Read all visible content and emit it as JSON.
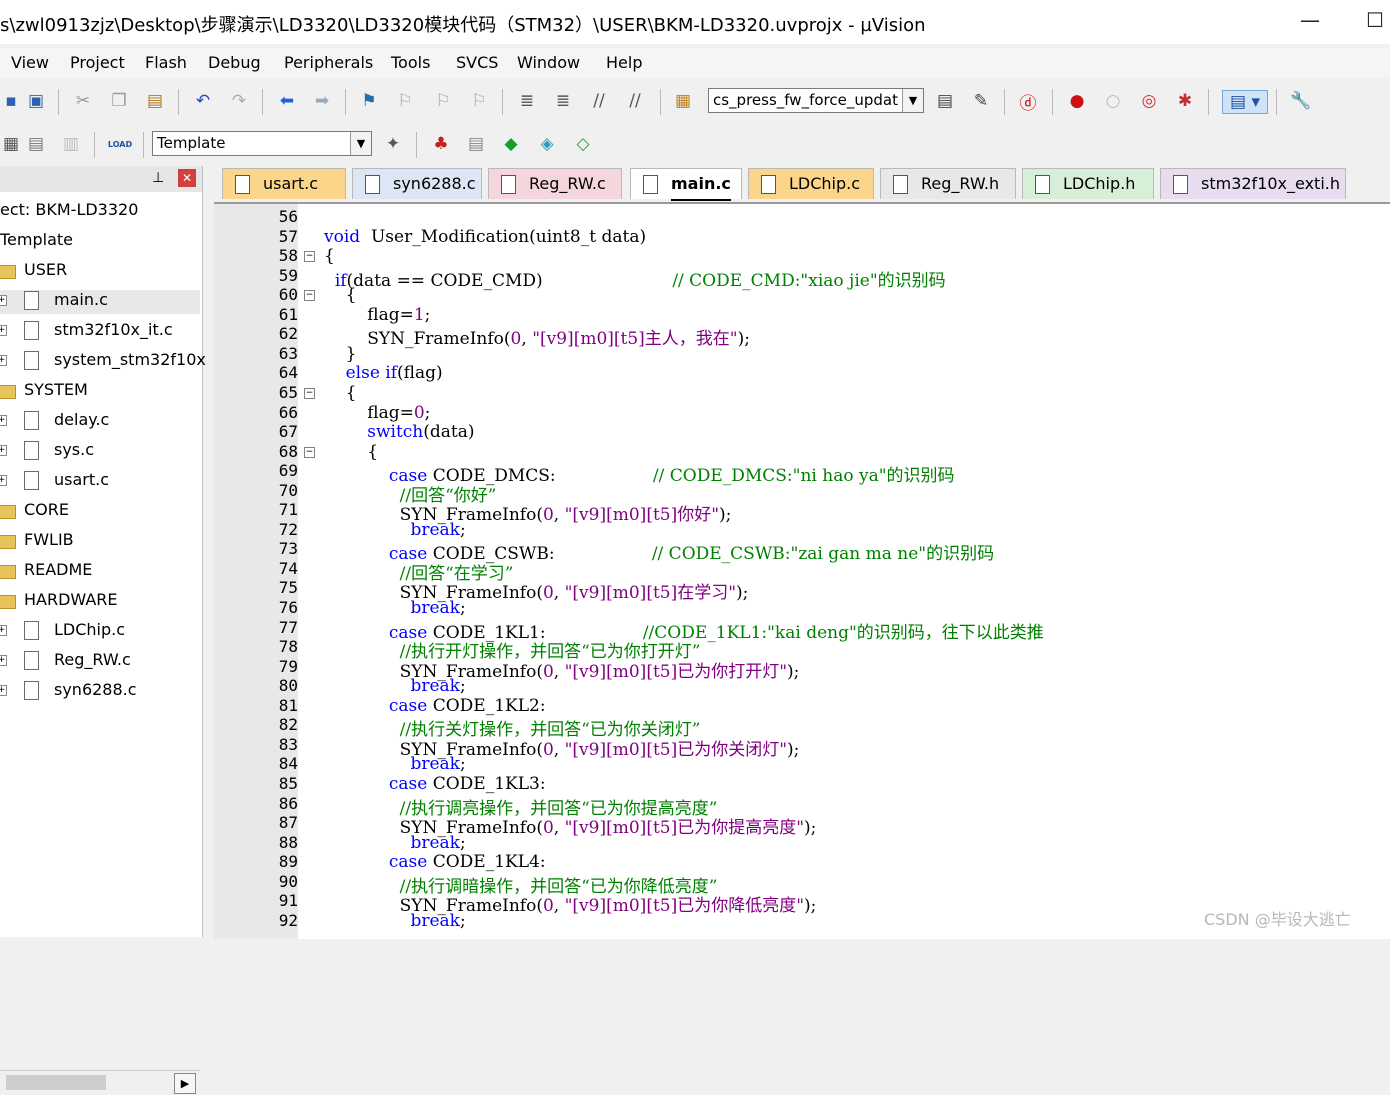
{
  "window": {
    "title": "s\\zwl0913zjz\\Desktop\\步骤演示\\LD3320\\LD3320模块代码（STM32）\\USER\\BKM-LD3320.uvprojx - µVision",
    "minimize": "—",
    "maximize": "☐"
  },
  "menu": [
    "View",
    "Project",
    "Flash",
    "Debug",
    "Peripherals",
    "Tools",
    "SVCS",
    "Window",
    "Help"
  ],
  "toolbar": {
    "function_combo": "cs_press_fw_force_updat",
    "target_combo": "Template",
    "load_label": "LOAD"
  },
  "project": {
    "pin": "⊥",
    "close": "✕",
    "title": "ect: BKM-LD3320",
    "target": "Template",
    "groups": [
      {
        "name": "USER",
        "files": [
          "main.c",
          "stm32f10x_it.c",
          "system_stm32f10x"
        ]
      },
      {
        "name": "SYSTEM",
        "files": [
          "delay.c",
          "sys.c",
          "usart.c"
        ]
      },
      {
        "name": "CORE",
        "files": []
      },
      {
        "name": "FWLIB",
        "files": []
      },
      {
        "name": "README",
        "files": []
      },
      {
        "name": "HARDWARE",
        "files": [
          "LDChip.c",
          "Reg_RW.c",
          "syn6288.c"
        ]
      }
    ]
  },
  "tabs": [
    {
      "label": "usart.c",
      "color": "#fbd58a"
    },
    {
      "label": "syn6288.c",
      "color": "#dce6f5"
    },
    {
      "label": "Reg_RW.c",
      "color": "#f5d6dc"
    },
    {
      "label": "main.c",
      "color": "#ffffff",
      "active": true
    },
    {
      "label": "LDChip.c",
      "color": "#fbd58a"
    },
    {
      "label": "Reg_RW.h",
      "color": "#e8e8e8"
    },
    {
      "label": "LDChip.h",
      "color": "#d6efd6"
    },
    {
      "label": "stm32f10x_exti.h",
      "color": "#e8dcf0"
    }
  ],
  "code_lines": [
    {
      "n": "56",
      "parts": []
    },
    {
      "n": "57",
      "parts": [
        [
          "kw",
          "void"
        ],
        [
          "",
          "  User_Modification(uint8_t data)"
        ]
      ]
    },
    {
      "n": "58",
      "parts": [
        [
          "",
          "{"
        ]
      ]
    },
    {
      "n": "59",
      "parts": [
        [
          "",
          "  "
        ],
        [
          "kw",
          "if"
        ],
        [
          "",
          "(data == CODE_CMD)                        "
        ],
        [
          "cm",
          "// CODE_CMD:\"xiao jie\"的识别码"
        ]
      ]
    },
    {
      "n": "60",
      "parts": [
        [
          "",
          "    {"
        ]
      ]
    },
    {
      "n": "61",
      "parts": [
        [
          "",
          "        flag="
        ],
        [
          "num",
          "1"
        ],
        [
          "",
          ";"
        ]
      ]
    },
    {
      "n": "62",
      "parts": [
        [
          "",
          "        SYN_FrameInfo("
        ],
        [
          "num",
          "0"
        ],
        [
          "",
          ", "
        ],
        [
          "st",
          "\"[v9][m0][t5]主人，我在\""
        ],
        [
          "",
          ");"
        ]
      ]
    },
    {
      "n": "63",
      "parts": [
        [
          "",
          "    }"
        ]
      ]
    },
    {
      "n": "64",
      "parts": [
        [
          "",
          "    "
        ],
        [
          "kw",
          "else if"
        ],
        [
          "",
          "(flag)"
        ]
      ]
    },
    {
      "n": "65",
      "parts": [
        [
          "",
          "    {"
        ]
      ]
    },
    {
      "n": "66",
      "parts": [
        [
          "",
          "        flag="
        ],
        [
          "num",
          "0"
        ],
        [
          "",
          ";"
        ]
      ]
    },
    {
      "n": "67",
      "parts": [
        [
          "",
          "        "
        ],
        [
          "kw",
          "switch"
        ],
        [
          "",
          "(data)"
        ]
      ]
    },
    {
      "n": "68",
      "parts": [
        [
          "",
          "        {"
        ]
      ]
    },
    {
      "n": "69",
      "parts": [
        [
          "",
          "            "
        ],
        [
          "kw",
          "case"
        ],
        [
          "",
          " CODE_DMCS:                  "
        ],
        [
          "cm",
          "// CODE_DMCS:\"ni hao ya\"的识别码"
        ]
      ]
    },
    {
      "n": "70",
      "parts": [
        [
          "",
          "              "
        ],
        [
          "cm",
          "//回答“你好”"
        ]
      ]
    },
    {
      "n": "71",
      "parts": [
        [
          "",
          "              SYN_FrameInfo("
        ],
        [
          "num",
          "0"
        ],
        [
          "",
          ", "
        ],
        [
          "st",
          "\"[v9][m0][t5]你好\""
        ],
        [
          "",
          ");"
        ]
      ]
    },
    {
      "n": "72",
      "parts": [
        [
          "",
          "                "
        ],
        [
          "kw",
          "break"
        ],
        [
          "",
          ";"
        ]
      ]
    },
    {
      "n": "73",
      "parts": [
        [
          "",
          "            "
        ],
        [
          "kw",
          "case"
        ],
        [
          "",
          " CODE_CSWB:                  "
        ],
        [
          "cm",
          "// CODE_CSWB:\"zai gan ma ne\"的识别码"
        ]
      ]
    },
    {
      "n": "74",
      "parts": [
        [
          "",
          "              "
        ],
        [
          "cm",
          "//回答“在学习”"
        ]
      ]
    },
    {
      "n": "75",
      "parts": [
        [
          "",
          "              SYN_FrameInfo("
        ],
        [
          "num",
          "0"
        ],
        [
          "",
          ", "
        ],
        [
          "st",
          "\"[v9][m0][t5]在学习\""
        ],
        [
          "",
          ");"
        ]
      ]
    },
    {
      "n": "76",
      "parts": [
        [
          "",
          "                "
        ],
        [
          "kw",
          "break"
        ],
        [
          "",
          ";"
        ]
      ]
    },
    {
      "n": "77",
      "parts": [
        [
          "",
          "            "
        ],
        [
          "kw",
          "case"
        ],
        [
          "",
          " CODE_1KL1:                  "
        ],
        [
          "cm",
          "//CODE_1KL1:\"kai deng\"的识别码，往下以此类推"
        ]
      ]
    },
    {
      "n": "78",
      "parts": [
        [
          "",
          "              "
        ],
        [
          "cm",
          "//执行开灯操作，并回答“已为你打开灯”"
        ]
      ]
    },
    {
      "n": "79",
      "parts": [
        [
          "",
          "              SYN_FrameInfo("
        ],
        [
          "num",
          "0"
        ],
        [
          "",
          ", "
        ],
        [
          "st",
          "\"[v9][m0][t5]已为你打开灯\""
        ],
        [
          "",
          ");"
        ]
      ]
    },
    {
      "n": "80",
      "parts": [
        [
          "",
          "                "
        ],
        [
          "kw",
          "break"
        ],
        [
          "",
          ";"
        ]
      ]
    },
    {
      "n": "81",
      "parts": [
        [
          "",
          "            "
        ],
        [
          "kw",
          "case"
        ],
        [
          "",
          " CODE_1KL2:"
        ]
      ]
    },
    {
      "n": "82",
      "parts": [
        [
          "",
          "              "
        ],
        [
          "cm",
          "//执行关灯操作，并回答“已为你关闭灯”"
        ]
      ]
    },
    {
      "n": "83",
      "parts": [
        [
          "",
          "              SYN_FrameInfo("
        ],
        [
          "num",
          "0"
        ],
        [
          "",
          ", "
        ],
        [
          "st",
          "\"[v9][m0][t5]已为你关闭灯\""
        ],
        [
          "",
          ");"
        ]
      ]
    },
    {
      "n": "84",
      "parts": [
        [
          "",
          "                "
        ],
        [
          "kw",
          "break"
        ],
        [
          "",
          ";"
        ]
      ]
    },
    {
      "n": "85",
      "parts": [
        [
          "",
          "            "
        ],
        [
          "kw",
          "case"
        ],
        [
          "",
          " CODE_1KL3:"
        ]
      ]
    },
    {
      "n": "86",
      "parts": [
        [
          "",
          "              "
        ],
        [
          "cm",
          "//执行调亮操作，并回答“已为你提高亮度”"
        ]
      ]
    },
    {
      "n": "87",
      "parts": [
        [
          "",
          "              SYN_FrameInfo("
        ],
        [
          "num",
          "0"
        ],
        [
          "",
          ", "
        ],
        [
          "st",
          "\"[v9][m0][t5]已为你提高亮度\""
        ],
        [
          "",
          ");"
        ]
      ]
    },
    {
      "n": "88",
      "parts": [
        [
          "",
          "                "
        ],
        [
          "kw",
          "break"
        ],
        [
          "",
          ";"
        ]
      ]
    },
    {
      "n": "89",
      "parts": [
        [
          "",
          "            "
        ],
        [
          "kw",
          "case"
        ],
        [
          "",
          " CODE_1KL4:"
        ]
      ]
    },
    {
      "n": "90",
      "parts": [
        [
          "",
          "              "
        ],
        [
          "cm",
          "//执行调暗操作，并回答“已为你降低亮度”"
        ]
      ]
    },
    {
      "n": "91",
      "parts": [
        [
          "",
          "              SYN_FrameInfo("
        ],
        [
          "num",
          "0"
        ],
        [
          "",
          ", "
        ],
        [
          "st",
          "\"[v9][m0][t5]已为你降低亮度\""
        ],
        [
          "",
          ");"
        ]
      ]
    },
    {
      "n": "92",
      "parts": [
        [
          "",
          "                "
        ],
        [
          "kw",
          "break"
        ],
        [
          "",
          ";"
        ]
      ]
    }
  ],
  "watermark": "CSDN @毕设大逃亡"
}
